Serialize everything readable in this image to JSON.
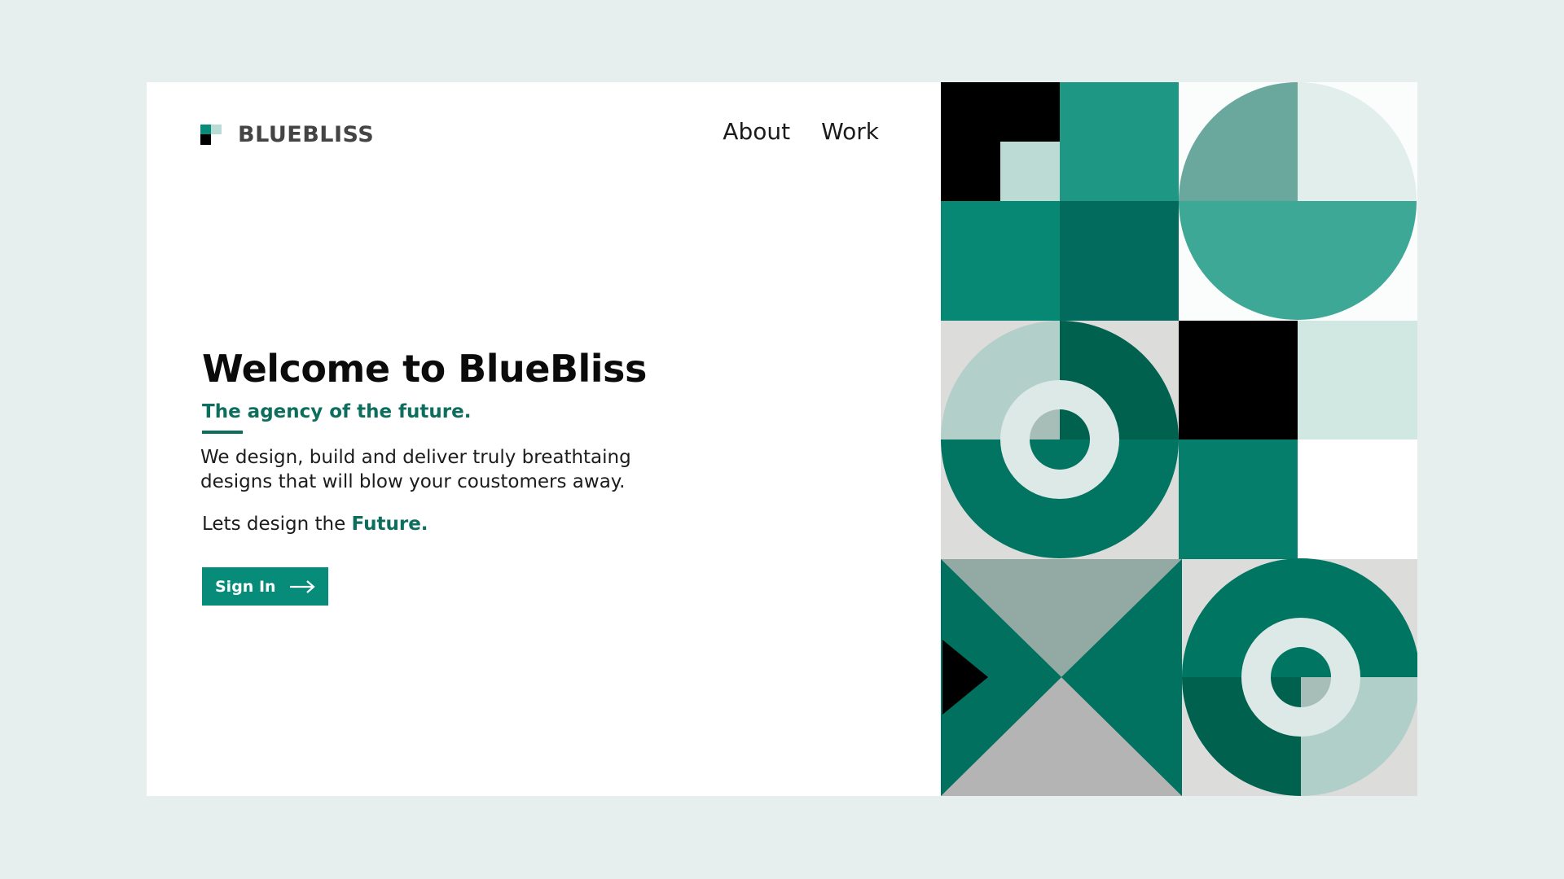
{
  "brand": {
    "name": "BLUEBLISS"
  },
  "nav": {
    "items": [
      "About",
      "Work"
    ]
  },
  "hero": {
    "title": "Welcome to BlueBliss",
    "subtitle": "The agency of the future.",
    "description": "We design, build and deliver truly breathtaing designs that will blow your coustomers away.",
    "tagline_prefix": "Lets design the ",
    "tagline_emphasis": "Future.",
    "cta_label": "Sign In",
    "cta_icon": "arrow-right-icon"
  },
  "colors": {
    "page_background": "#e6efed",
    "brand_teal": "#0d6e5e",
    "button_teal": "#078c79",
    "black": "#000000"
  }
}
